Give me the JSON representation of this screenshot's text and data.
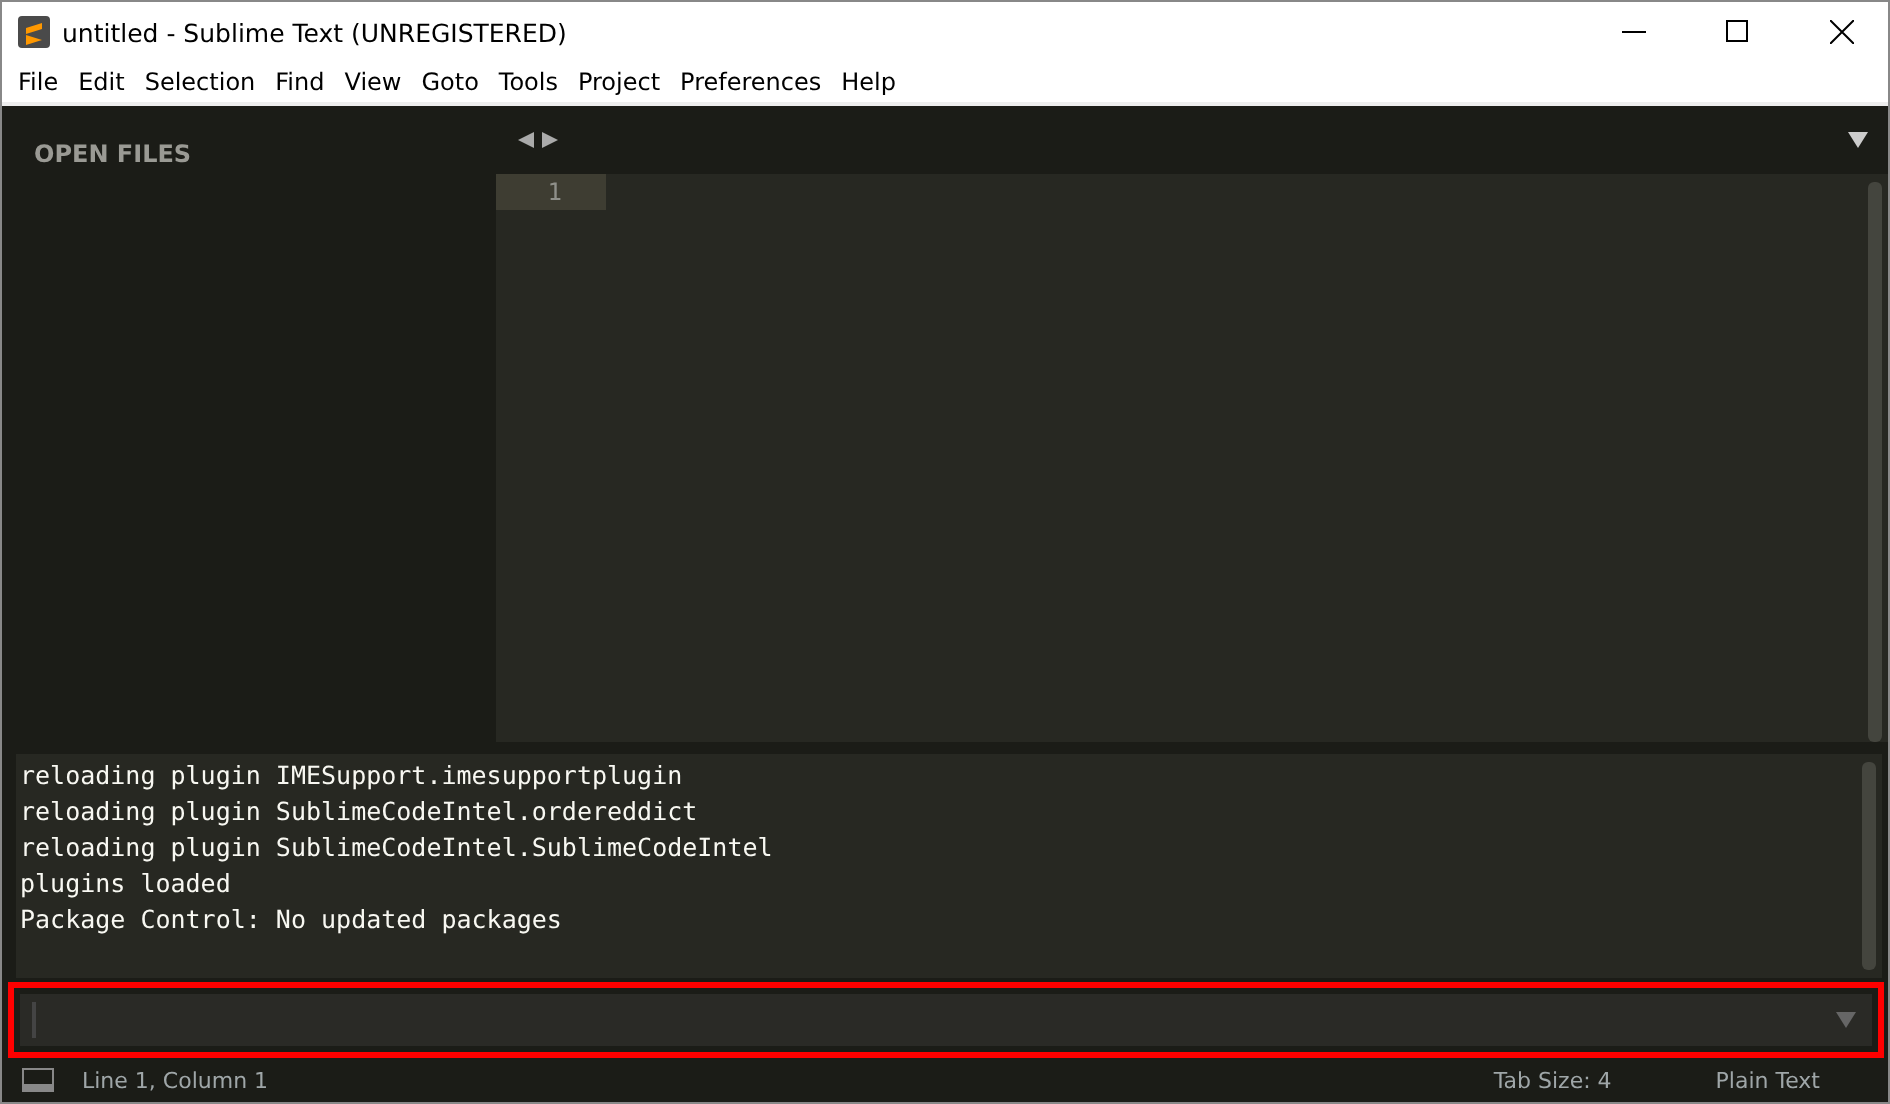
{
  "window": {
    "title": "untitled - Sublime Text (UNREGISTERED)"
  },
  "menu": [
    "File",
    "Edit",
    "Selection",
    "Find",
    "View",
    "Goto",
    "Tools",
    "Project",
    "Preferences",
    "Help"
  ],
  "sidebar": {
    "heading": "OPEN FILES"
  },
  "editor": {
    "line_numbers": [
      "1"
    ]
  },
  "console": {
    "lines": [
      "reloading plugin IMESupport.imesupportplugin",
      "reloading plugin SublimeCodeIntel.ordereddict",
      "reloading plugin SublimeCodeIntel.SublimeCodeIntel",
      "plugins loaded",
      "Package Control: No updated packages"
    ],
    "input": {
      "highlighted": true
    }
  },
  "status_bar": {
    "position": "Line 1, Column 1",
    "tab_size": "Tab Size: 4",
    "syntax": "Plain Text"
  }
}
